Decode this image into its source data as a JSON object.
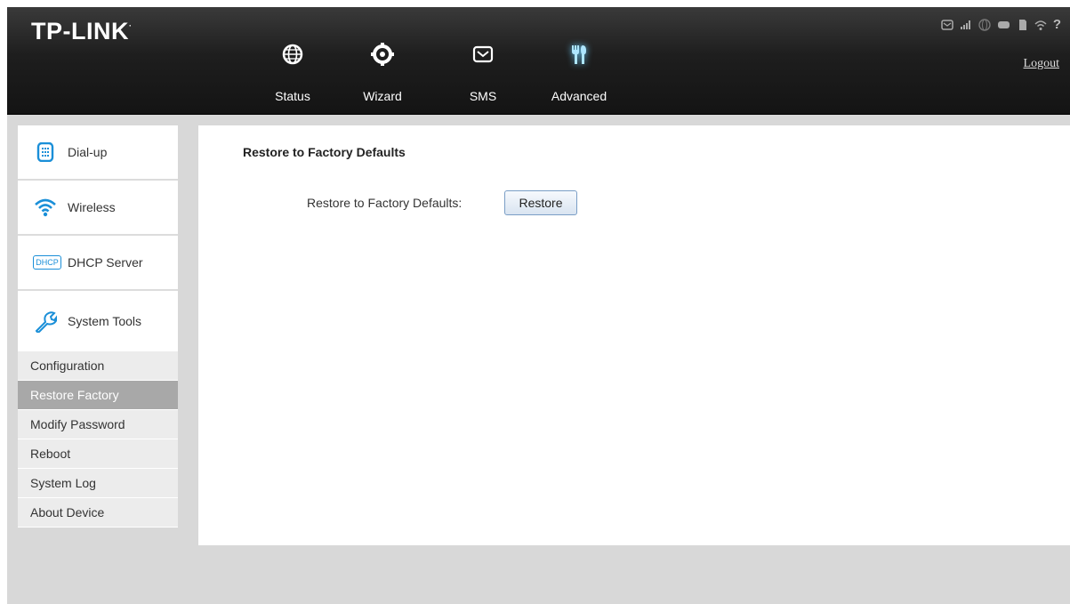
{
  "brand": {
    "logo_text": "TP-LINK",
    "registered_mark": "·"
  },
  "header": {
    "nav": [
      {
        "label": "Status",
        "icon": "globe-icon"
      },
      {
        "label": "Wizard",
        "icon": "gear-icon"
      },
      {
        "label": "SMS",
        "icon": "envelope-icon"
      },
      {
        "label": "Advanced",
        "icon": "tools-icon",
        "active": true
      }
    ],
    "status_icons": [
      "sms-status-icon",
      "signal-icon",
      "network-globe-icon",
      "battery-icon",
      "sim-icon",
      "wifi-icon",
      "help-icon"
    ],
    "help_glyph": "?",
    "logout_label": "Logout"
  },
  "sidebar": {
    "main_items": [
      {
        "label": "Dial-up",
        "icon": "dialup-icon"
      },
      {
        "label": "Wireless",
        "icon": "wifi-icon"
      },
      {
        "label": "DHCP Server",
        "icon": "dhcp-icon",
        "icon_text": "DHCP"
      },
      {
        "label": "System Tools",
        "icon": "wrench-icon"
      }
    ],
    "sub_items": [
      {
        "label": "Configuration"
      },
      {
        "label": "Restore Factory",
        "active": true
      },
      {
        "label": "Modify Password"
      },
      {
        "label": "Reboot"
      },
      {
        "label": "System Log"
      },
      {
        "label": "About Device"
      }
    ]
  },
  "main": {
    "section_title": "Restore to Factory Defaults",
    "field_label": "Restore to Factory Defaults:",
    "button_label": "Restore"
  },
  "colors": {
    "accent_glow": "#6bd0ff",
    "icon_blue": "#1a8fd8",
    "header_bg": "#1e1e1e",
    "active_sub_bg": "#a8a8a8"
  }
}
